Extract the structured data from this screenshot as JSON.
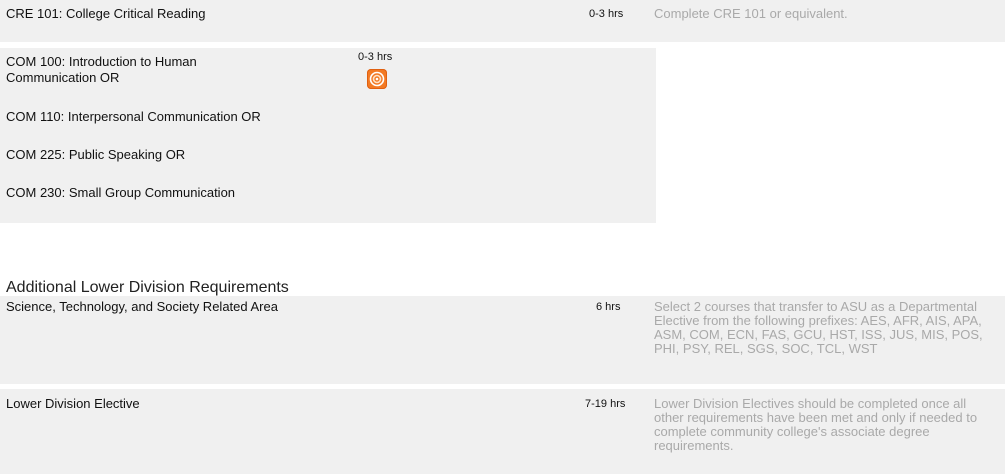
{
  "rows": {
    "cre": {
      "course": "CRE 101: College Critical Reading",
      "hours": "0-3 hrs",
      "note": "Complete CRE 101 or equivalent."
    },
    "com": {
      "options": [
        "COM 100: Introduction to Human Communication OR",
        "COM 110: Interpersonal Communication OR",
        "COM 225: Public Speaking OR",
        "COM 230: Small Group Communication"
      ],
      "hours": "0-3 hrs",
      "icon": "orange-swirl-icon"
    }
  },
  "additional": {
    "title": "Additional Lower Division Requirements",
    "items": [
      {
        "course": "Science, Technology, and Society Related Area",
        "hours": "6 hrs",
        "note": "Select 2 courses that transfer to ASU as a Departmental Elective from the following prefixes: AES, AFR, AIS, APA, ASM, COM, ECN, FAS, GCU, HST, ISS, JUS, MIS, POS, PHI, PSY, REL, SGS, SOC, TCL, WST"
      },
      {
        "course": "Lower Division Elective",
        "hours": "7-19 hrs",
        "note": "Lower Division Electives should be completed once all other requirements have been met and only if needed to complete community college's associate degree requirements."
      }
    ]
  },
  "colors": {
    "row_background": "#f0f0f0",
    "note_text": "#a9a9a9",
    "icon_orange": "#f37a24"
  }
}
